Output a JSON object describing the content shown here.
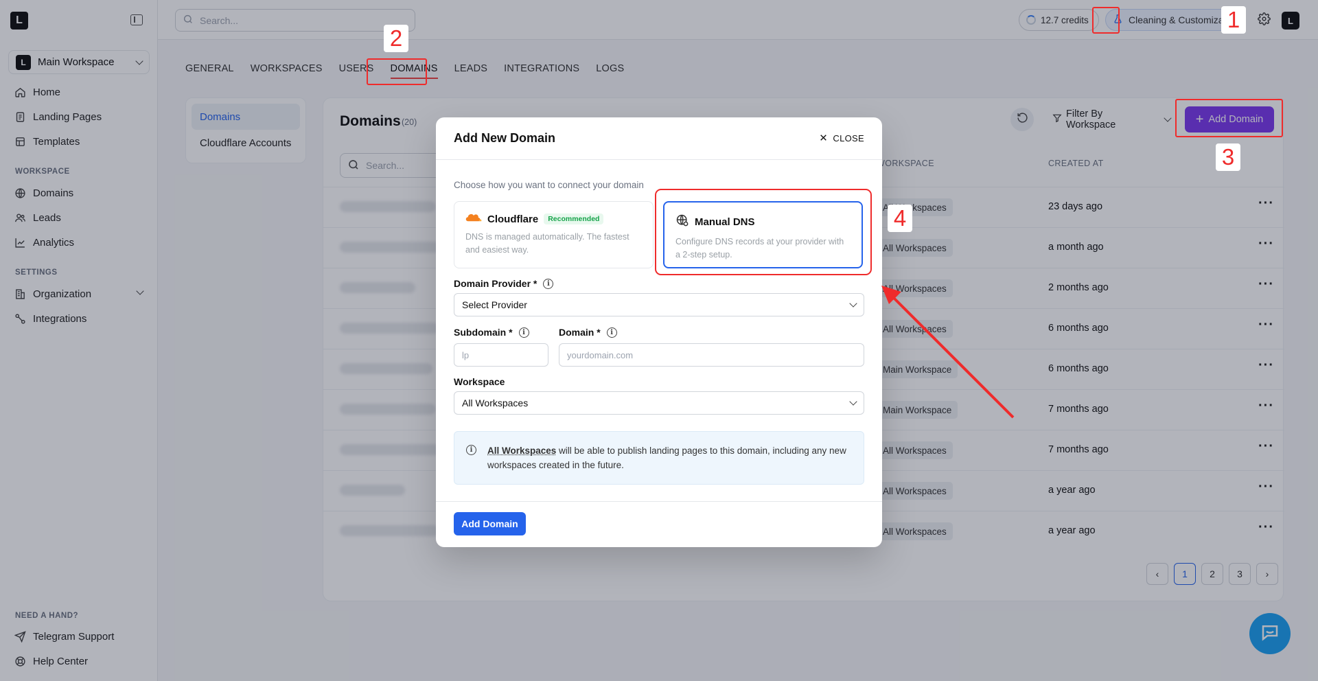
{
  "app": {
    "logo_text": "L",
    "workspace_name": "Main Workspace"
  },
  "topbar": {
    "search_placeholder": "Search...",
    "credits": "12.7 credits",
    "task_chip": "Cleaning & Customiza",
    "avatar_text": "L"
  },
  "sidebar": {
    "items_main": [
      {
        "label": "Home",
        "icon": "home-icon"
      },
      {
        "label": "Landing Pages",
        "icon": "document-icon"
      },
      {
        "label": "Templates",
        "icon": "template-icon"
      }
    ],
    "section_workspace": "WORKSPACE",
    "items_workspace": [
      {
        "label": "Domains",
        "icon": "globe-icon"
      },
      {
        "label": "Leads",
        "icon": "users-icon"
      },
      {
        "label": "Analytics",
        "icon": "chart-icon"
      }
    ],
    "section_settings": "SETTINGS",
    "items_settings": [
      {
        "label": "Organization",
        "icon": "building-icon"
      },
      {
        "label": "Integrations",
        "icon": "plug-icon"
      }
    ],
    "section_help": "NEED A HAND?",
    "items_help": [
      {
        "label": "Telegram Support",
        "icon": "send-icon"
      },
      {
        "label": "Help Center",
        "icon": "help-icon"
      }
    ]
  },
  "settings_tabs": [
    "GENERAL",
    "WORKSPACES",
    "USERS",
    "DOMAINS",
    "LEADS",
    "INTEGRATIONS",
    "LOGS"
  ],
  "sub_nav": [
    "Domains",
    "Cloudflare Accounts"
  ],
  "panel": {
    "title": "Domains",
    "count": "(20)",
    "filter_label": "Filter By Workspace",
    "add_domain": "Add Domain",
    "search_placeholder": "Search...",
    "col_workspace": "WORKSPACE",
    "col_created": "CREATED AT",
    "rows": [
      {
        "workspace": "All Workspaces",
        "created": "23 days ago"
      },
      {
        "workspace": "All Workspaces",
        "created": "a month ago"
      },
      {
        "workspace": "All Workspaces",
        "created": "2 months ago"
      },
      {
        "workspace": "All Workspaces",
        "created": "6 months ago"
      },
      {
        "workspace": "Main Workspace",
        "created": "6 months ago"
      },
      {
        "workspace": "Main Workspace",
        "created": "7 months ago"
      },
      {
        "workspace": "All Workspaces",
        "created": "7 months ago"
      },
      {
        "workspace": "All Workspaces",
        "created": "a year ago"
      },
      {
        "workspace": "All Workspaces",
        "created": "a year ago"
      }
    ],
    "pages": [
      "1",
      "2",
      "3"
    ],
    "prev": "‹",
    "next": "›"
  },
  "modal": {
    "title": "Add New Domain",
    "close_label": "CLOSE",
    "hint": "Choose how you want to connect your domain",
    "option_cloudflare": {
      "title": "Cloudflare",
      "badge": "Recommended",
      "desc": "DNS is managed automatically. The fastest and easiest way."
    },
    "option_manual": {
      "title": "Manual DNS",
      "desc": "Configure DNS records at your provider with a 2-step setup."
    },
    "provider_label": "Domain Provider *",
    "provider_value": "Select Provider",
    "subdomain_label": "Subdomain *",
    "subdomain_placeholder": "lp",
    "domain_label": "Domain *",
    "domain_placeholder": "yourdomain.com",
    "workspace_label": "Workspace",
    "workspace_value": "All Workspaces",
    "note_link": "All Workspaces",
    "note_text": " will be able to publish landing pages to this domain, including any new workspaces created in the future.",
    "submit": "Add Domain"
  },
  "annotations": [
    "1",
    "2",
    "3",
    "4"
  ],
  "colors": {
    "accent_blue": "#2563eb",
    "add_domain_purple": "#7c3aed",
    "annotation_red": "#ef2b2b",
    "recommended_green": "#16a34a"
  }
}
